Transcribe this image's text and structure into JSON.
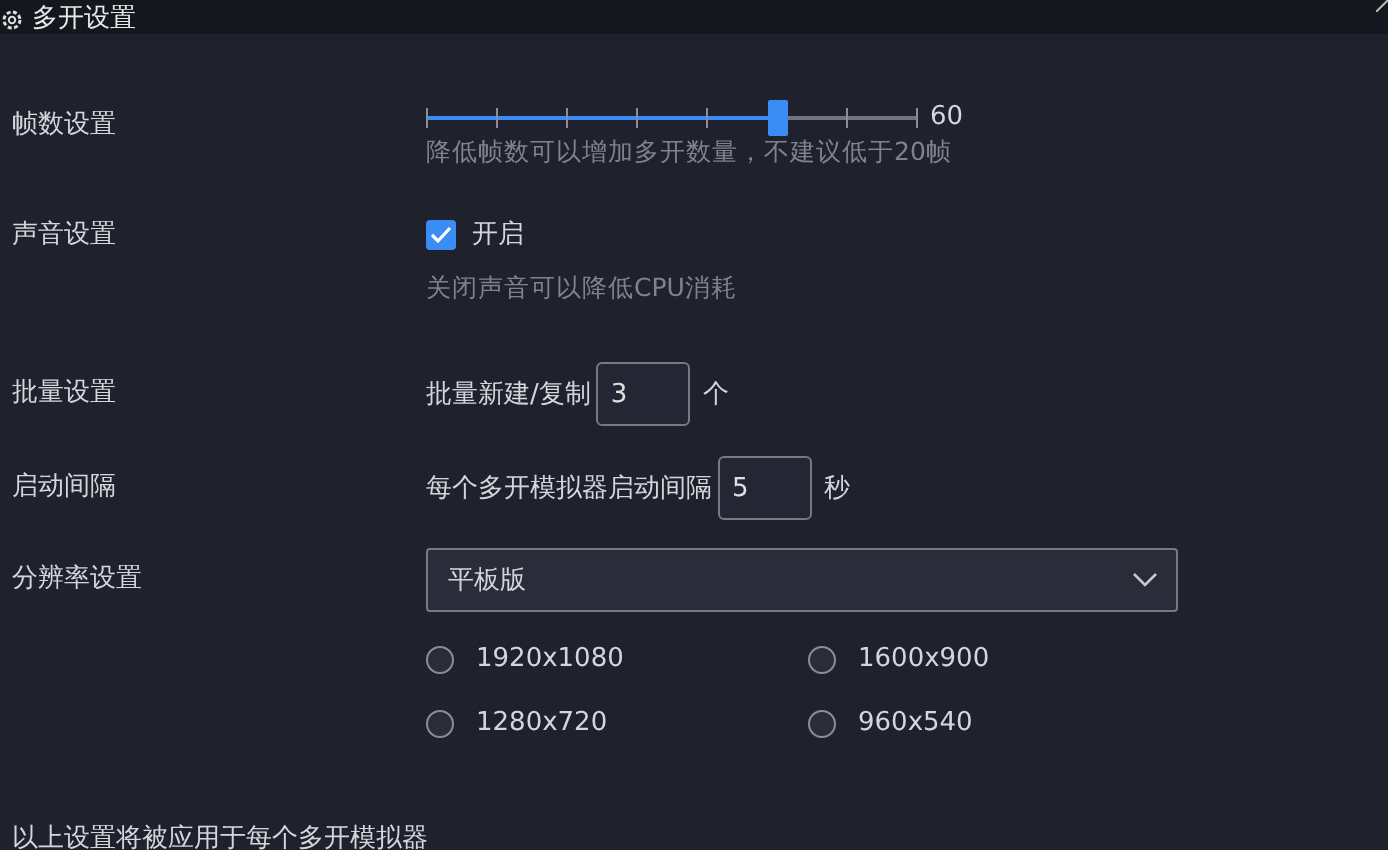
{
  "window": {
    "title": "多开设置"
  },
  "settings": [
    {
      "kind": "slider",
      "label": "帧数设置",
      "level": 0.714,
      "reading": "60",
      "hint": "降低帧数可以增加多开数量，不建议低于20帧"
    },
    {
      "kind": "checkbox",
      "label": "声音设置",
      "checked": true,
      "text": "开启",
      "hint": "关闭声音可以降低CPU消耗"
    },
    {
      "kind": "number",
      "label": "批量设置",
      "prefix": "批量新建/复制",
      "value": "3",
      "unit": "个"
    },
    {
      "kind": "number",
      "label": "启动间隔",
      "prefix": "每个多开模拟器启动间隔",
      "value": "5",
      "unit": "秒"
    },
    {
      "kind": "select",
      "label": "分辨率设置",
      "value": "平板版",
      "options": [
        {
          "label": "1920x1080",
          "selected": false
        },
        {
          "label": "1600x900",
          "selected": false
        },
        {
          "label": "1280x720",
          "selected": false
        },
        {
          "label": "960x540",
          "selected": false
        }
      ]
    }
  ],
  "footer": "以上设置将被应用于每个多开模拟器"
}
